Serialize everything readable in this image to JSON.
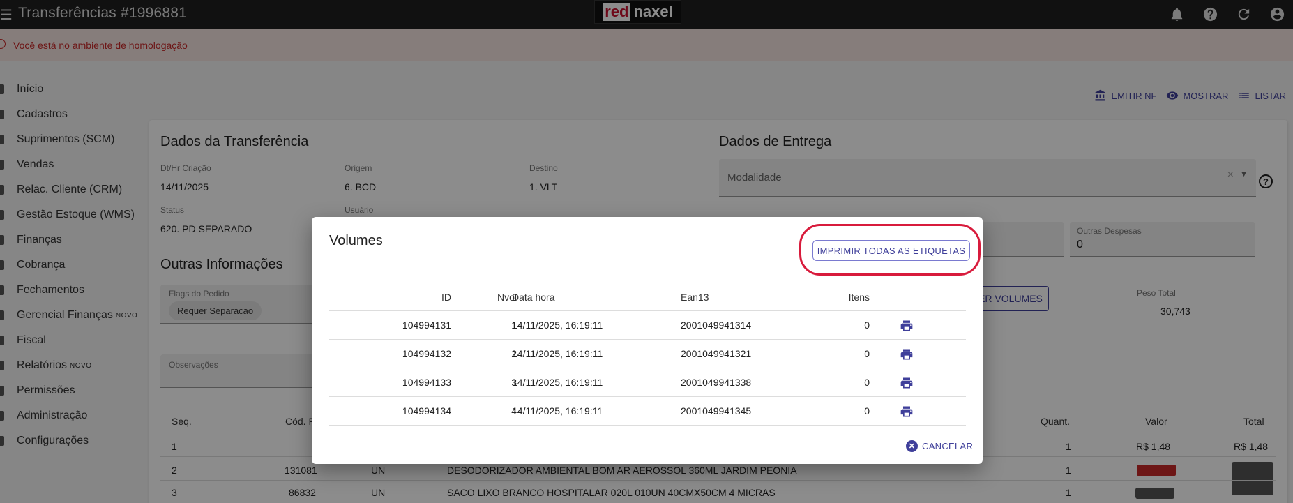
{
  "topbar": {
    "title": "Transferências #1996881",
    "logo_red": "red",
    "logo_white": "naxel",
    "icons": [
      "bell-icon",
      "help-icon",
      "refresh-icon",
      "account-icon"
    ]
  },
  "env_warning": "Você está no ambiente de homologação",
  "sidebar": {
    "items": [
      {
        "label": "Início"
      },
      {
        "label": "Cadastros"
      },
      {
        "label": "Suprimentos (SCM)"
      },
      {
        "label": "Vendas"
      },
      {
        "label": "Relac. Cliente (CRM)"
      },
      {
        "label": "Gestão Estoque (WMS)"
      },
      {
        "label": "Finanças"
      },
      {
        "label": "Cobrança"
      },
      {
        "label": "Fechamentos"
      },
      {
        "label": "Gerencial Finanças",
        "badge": "NOVO"
      },
      {
        "label": "Fiscal"
      },
      {
        "label": "Relatórios",
        "badge": "NOVO"
      },
      {
        "label": "Permissões"
      },
      {
        "label": "Administração"
      },
      {
        "label": "Configurações"
      }
    ]
  },
  "actions": {
    "emitir_nf": "EMITIR NF",
    "mostrar": "MOSTRAR",
    "listar": "LISTAR"
  },
  "transfer": {
    "title": "Dados da Transferência",
    "created_label": "Dt/Hr Criação",
    "created_value": "14/11/2025",
    "origin_label": "Origem",
    "origin_value": "6. BCD",
    "dest_label": "Destino",
    "dest_value": "1. VLT",
    "status_label": "Status",
    "status_value": "620. PD SEPARADO",
    "user_label": "Usuário"
  },
  "other_info": {
    "title": "Outras Informações",
    "flags_label": "Flags do Pedido",
    "flag_chip": "Requer Separacao",
    "obs_label": "Observações"
  },
  "delivery": {
    "title": "Dados de Entrega",
    "modality_placeholder": "Modalidade",
    "other_expenses_label": "Outras Despesas",
    "other_expenses_value": "0",
    "volumes_btn_partial": "ER VOLUMES",
    "weight_label": "Peso Total",
    "weight_value": "30,743"
  },
  "items_table": {
    "headers": {
      "seq": "Seq.",
      "cod": "Cód. P",
      "quant": "Quant.",
      "valor": "Valor",
      "total": "Total"
    },
    "rows": [
      {
        "seq": "1",
        "cod": "",
        "un": "",
        "desc": "",
        "quant": "1",
        "valor": "R$ 1,48",
        "total": "R$ 1,48"
      },
      {
        "seq": "2",
        "cod": "131081",
        "un": "UN",
        "desc": "DESODORIZADOR AMBIENTAL BOM AR AEROSSOL 360ML JARDIM PEONIA",
        "quant": "1",
        "valor": "",
        "total": ""
      },
      {
        "seq": "3",
        "cod": "86832",
        "un": "UN",
        "desc": "SACO LIXO BRANCO HOSPITALAR 020L 010UN 40CMX50CM 4 MICRAS",
        "quant": "1",
        "valor": "",
        "total": ""
      }
    ]
  },
  "modal": {
    "title": "Volumes",
    "print_all": "IMPRIMIR TODAS AS ETIQUETAS",
    "headers": {
      "id": "ID",
      "nvol": "Nvol",
      "datahora": "Data hora",
      "ean13": "Ean13",
      "itens": "Itens"
    },
    "rows": [
      {
        "id": "104994131",
        "nvol": "1",
        "datahora": "14/11/2025, 16:19:11",
        "ean13": "2001049941314",
        "itens": "0"
      },
      {
        "id": "104994132",
        "nvol": "2",
        "datahora": "14/11/2025, 16:19:11",
        "ean13": "2001049941321",
        "itens": "0"
      },
      {
        "id": "104994133",
        "nvol": "3",
        "datahora": "14/11/2025, 16:19:11",
        "ean13": "2001049941338",
        "itens": "0"
      },
      {
        "id": "104994134",
        "nvol": "4",
        "datahora": "14/11/2025, 16:19:11",
        "ean13": "2001049941345",
        "itens": "0"
      }
    ],
    "cancel": "CANCELAR"
  },
  "colors": {
    "accent": "#3f3f9a",
    "warning": "#c62828",
    "highlight": "#d81b3c"
  }
}
